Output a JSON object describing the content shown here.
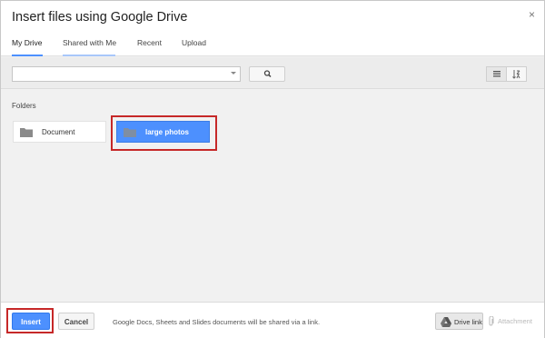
{
  "dialog": {
    "title": "Insert files using Google Drive",
    "close_glyph": "×"
  },
  "tabs": [
    {
      "label": "My Drive",
      "active": true
    },
    {
      "label": "Shared with Me",
      "active": false
    },
    {
      "label": "Recent",
      "active": false
    },
    {
      "label": "Upload",
      "active": false
    }
  ],
  "toolbar": {
    "search_value": "",
    "search_placeholder": "",
    "icons": [
      "chevron-down-icon",
      "search-icon",
      "list-view-icon",
      "sort-az-icon"
    ]
  },
  "folders_section": {
    "label": "Folders",
    "items": [
      {
        "name": "Document",
        "selected": false,
        "icon": "folder-icon"
      },
      {
        "name": "large photos",
        "selected": true,
        "icon": "folder-icon"
      }
    ]
  },
  "footer": {
    "insert_label": "Insert",
    "cancel_label": "Cancel",
    "note": "Google Docs, Sheets and Slides documents will be shared via a link.",
    "drive_link_label": "Drive link",
    "attachment_label": "Attachment",
    "drive_link_active": true
  },
  "colors": {
    "accent": "#4d90fe",
    "highlight": "#c62828",
    "background": "#f1f1f1"
  }
}
